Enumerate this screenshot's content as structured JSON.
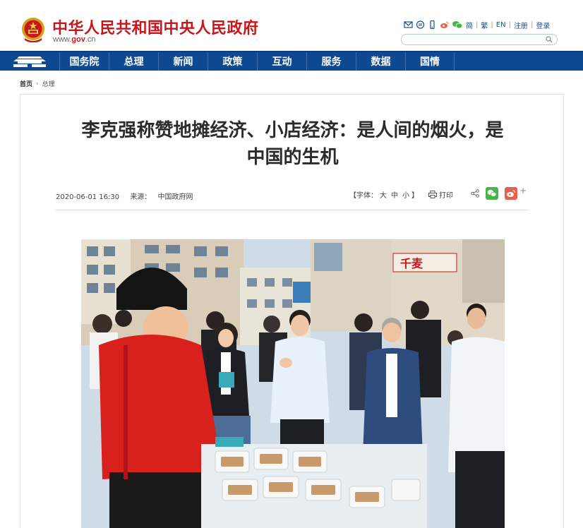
{
  "header": {
    "site_title": "中华人民共和国中央人民政府",
    "domain_prefix": "www.",
    "domain_gov": "gov",
    "domain_suffix": ".cn",
    "links": {
      "simplified": "简",
      "traditional": "繁",
      "english": "EN",
      "register": "注册",
      "login": "登录"
    },
    "search_placeholder": ""
  },
  "nav": {
    "items": [
      "国务院",
      "总理",
      "新闻",
      "政策",
      "互动",
      "服务",
      "数据",
      "国情"
    ]
  },
  "breadcrumb": {
    "home": "首页",
    "current": "总理"
  },
  "article": {
    "title_line1": "李克强称赞地摊经济、小店经济：是人间的烟火，是",
    "title_line2": "中国的生机",
    "date": "2020-06-01 16:30",
    "source_label": "来源：",
    "source": "中国政府网",
    "font_label": "【字体：",
    "font_large": "大",
    "font_medium": "中",
    "font_small": "小",
    "font_close": "】",
    "print": "打印",
    "plus": "+"
  },
  "photo": {
    "shop_sign": "千麦"
  },
  "colors": {
    "brand_red": "#c8161d",
    "nav_blue": "#0e4a92",
    "wechat_green": "#47b648",
    "weibo_red": "#e6604f"
  }
}
